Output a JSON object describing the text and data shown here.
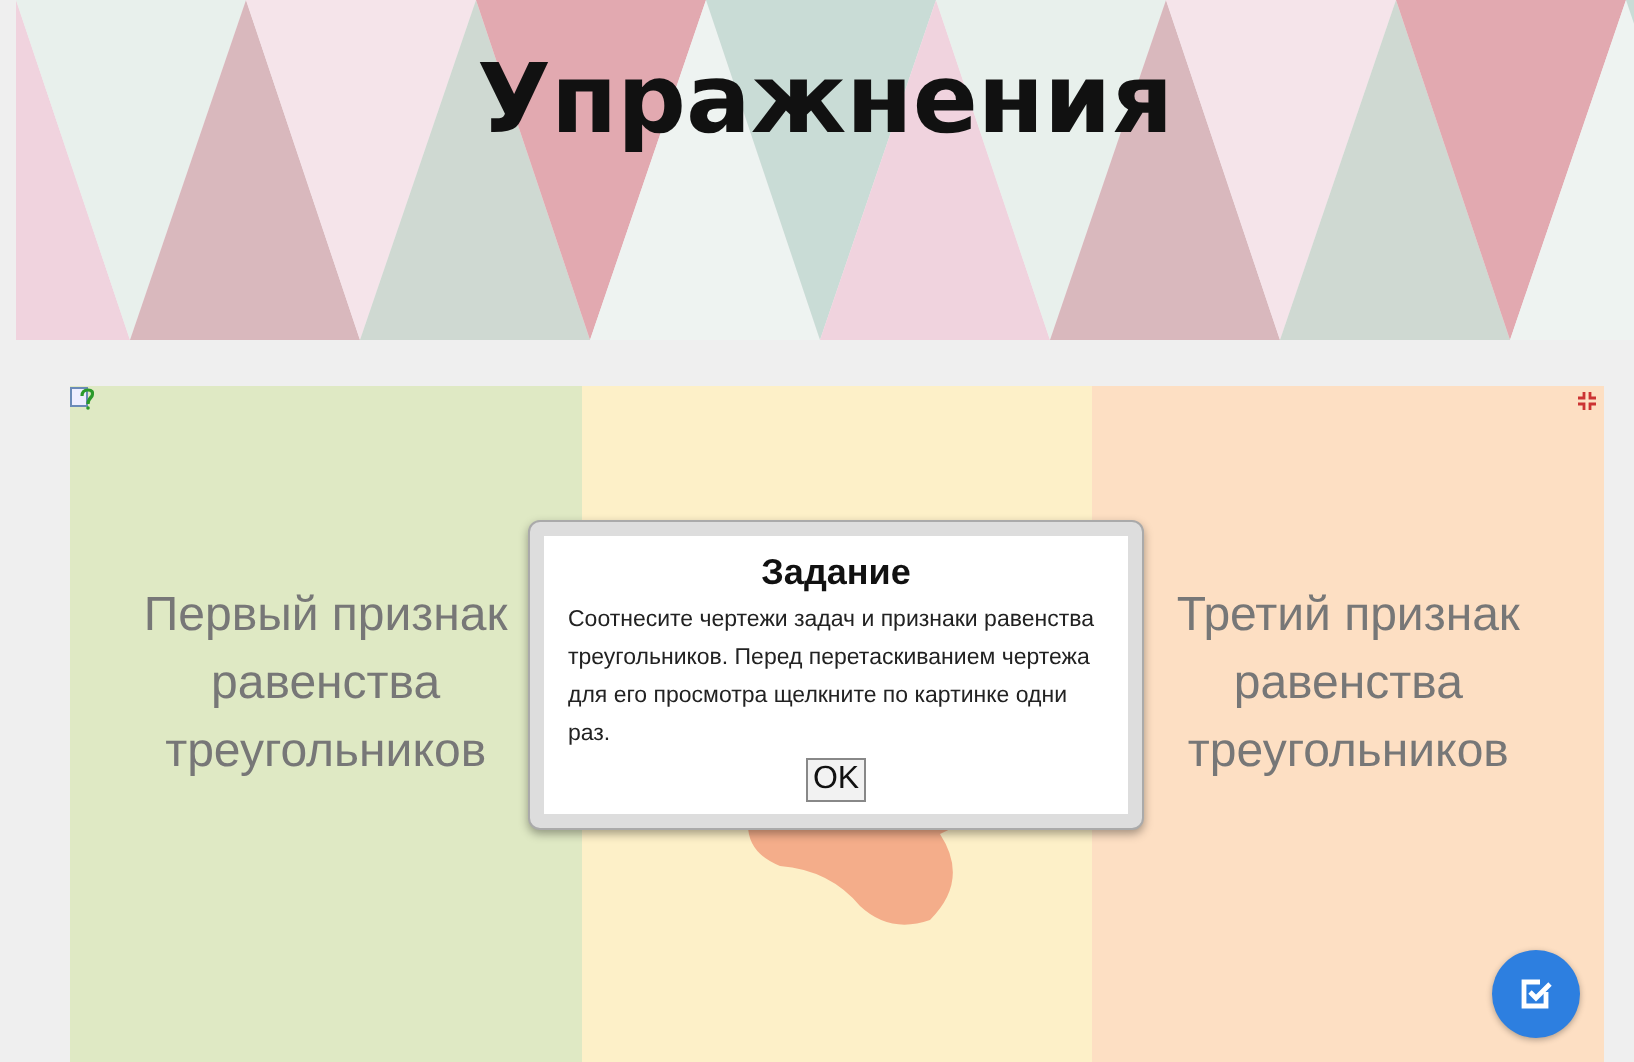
{
  "header": {
    "title": "Упражнения"
  },
  "columns": [
    {
      "label": "Первый признак равенства треугольников",
      "color": "#dfe9c4"
    },
    {
      "color": "#fdf0c8"
    },
    {
      "label": "Третий признак равенства треугольников",
      "color": "#fddfc3"
    }
  ],
  "dialog": {
    "title": "Задание",
    "text": "Соотнесите чертежи задач и признаки равенства треугольников. Перед перетаскиванием чертежа для его просмотра щелкните по картинке одни раз.",
    "button": "OK"
  }
}
